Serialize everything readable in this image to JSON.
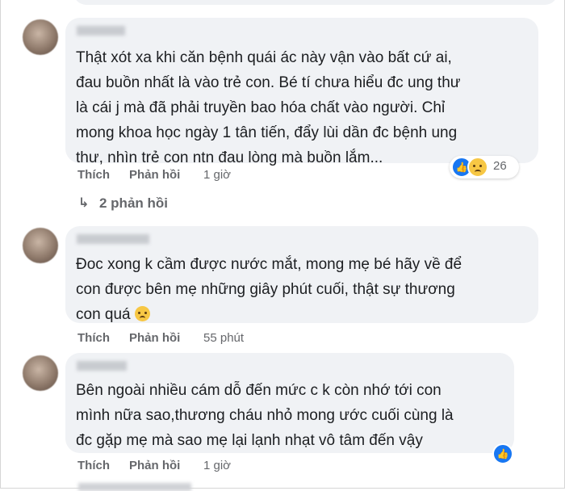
{
  "comments": [
    {
      "lines": [
        "Thật xót xa khi căn bệnh quái ác này vận vào bất cứ ai,",
        "đau buồn nhất là vào trẻ con. Bé tí chưa hiểu đc ung thư",
        "là cái j mà đã phải truyền bao hóa chất vào người. Chỉ",
        "mong khoa học ngày 1 tân tiến, đẩy lùi dần đc bệnh ung",
        "thư, nhìn trẻ con ntn đau lòng mà buồn lắm..."
      ],
      "like_label": "Thích",
      "reply_label": "Phản hồi",
      "time": "1 giờ",
      "reaction_count": "26",
      "replies_link": "2 phản hồi"
    },
    {
      "lines": [
        "Đoc xong k cầm được nước mắt, mong mẹ bé hãy về để",
        "con được bên mẹ những giây phút cuối, thật sự thương",
        "con quá"
      ],
      "like_label": "Thích",
      "reply_label": "Phản hồi",
      "time": "55 phút"
    },
    {
      "lines": [
        "Bên ngoài nhiều cám dỗ đến mức c k còn nhớ tới con",
        "mình nữa sao,thương cháu nhỏ mong ước cuối cùng là",
        "đc gặp mẹ mà sao mẹ lại lạnh nhạt vô tâm đến vậy"
      ],
      "like_label": "Thích",
      "reply_label": "Phản hồi",
      "time": "1 giờ"
    }
  ],
  "icons": {
    "reply_arrow": "reply-arrow-icon",
    "like": "like-reaction-icon",
    "sad": "sad-reaction-icon"
  },
  "colors": {
    "bubble": "#f0f2f5",
    "meta_text": "#65676b",
    "like_blue": "#1877f2"
  }
}
